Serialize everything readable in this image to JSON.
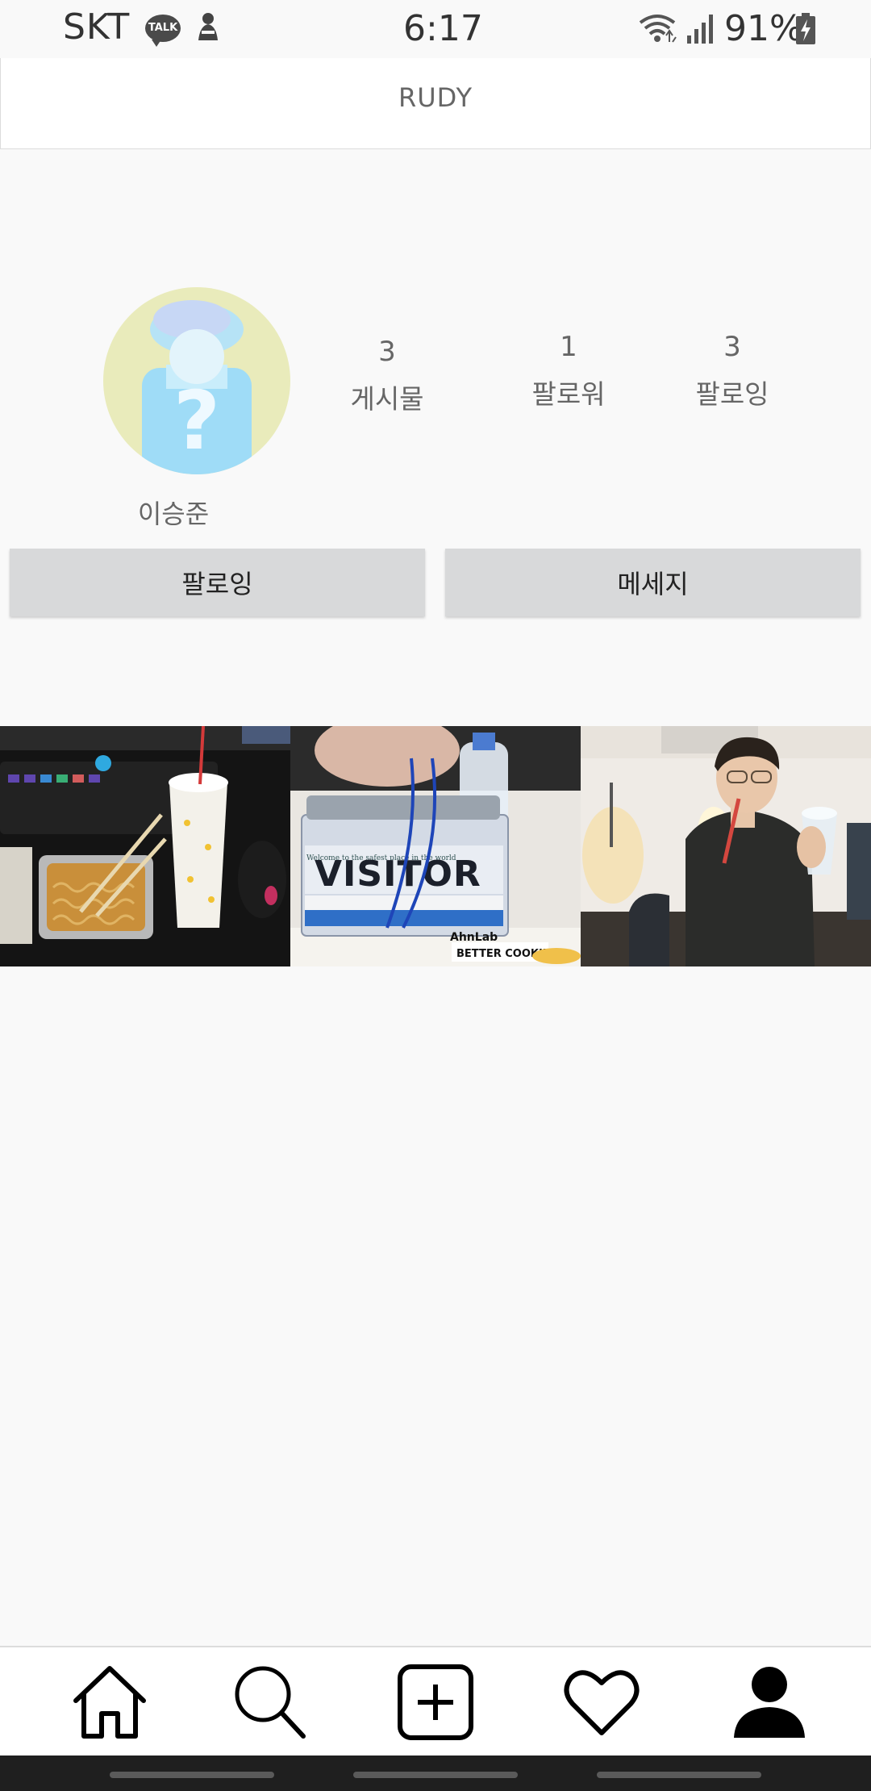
{
  "status_bar": {
    "carrier": "SKT",
    "talk_badge": "TALK",
    "time": "6:17",
    "battery": "91%"
  },
  "header": {
    "title": "RUDY"
  },
  "profile": {
    "username": "이승준",
    "stats": [
      {
        "value": "3",
        "label": "게시물"
      },
      {
        "value": "1",
        "label": "팔로워"
      },
      {
        "value": "3",
        "label": "팔로잉"
      }
    ],
    "follow_button": "팔로잉",
    "message_button": "메세지"
  },
  "grid": {
    "visitor_badge_text": "VISITOR",
    "visitor_tagline": "Welcome to the safest place in the world",
    "visitor_brand": "AhnLab",
    "cookie_sign": "BETTER COOKIE"
  },
  "icons": {
    "status": [
      "kakaotalk-icon",
      "app-notification-icon",
      "wifi-icon",
      "signal-icon",
      "battery-charging-icon"
    ],
    "nav": [
      "home-icon",
      "search-icon",
      "add-post-icon",
      "heart-icon",
      "profile-icon"
    ]
  },
  "colors": {
    "background": "#f9f9f9",
    "button": "#d8d9da",
    "avatar_bg": "#e9ebbb",
    "avatar_figure": "#9fdcf7"
  }
}
